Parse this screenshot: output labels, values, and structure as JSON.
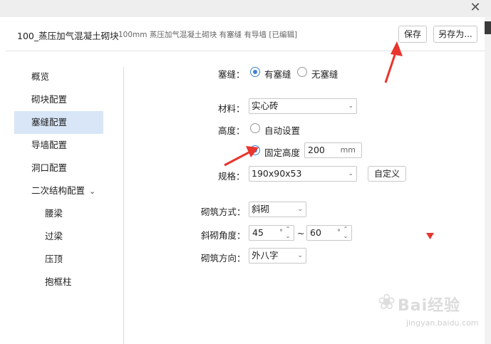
{
  "window": {
    "close_glyph": "✕"
  },
  "header": {
    "title": "100_蒸压加气混凝土砌块",
    "subtitle": "100mm 蒸压加气混凝土砌块 有塞缝 有导墙 [已编辑]",
    "save_label": "保存",
    "save_as_label": "另存为..."
  },
  "sidebar": {
    "items": [
      {
        "label": "概览"
      },
      {
        "label": "砌块配置"
      },
      {
        "label": "塞缝配置"
      },
      {
        "label": "导墙配置"
      },
      {
        "label": "洞口配置"
      },
      {
        "label": "二次结构配置"
      },
      {
        "label": "腰梁"
      },
      {
        "label": "过梁"
      },
      {
        "label": "压顶"
      },
      {
        "label": "抱框柱"
      }
    ],
    "active": "塞缝配置",
    "expand_glyph": "⌄"
  },
  "form": {
    "seam_label": "塞缝：",
    "seam_yes": "有塞缝",
    "seam_no": "无塞缝",
    "seam_selected": "有塞缝",
    "material_label": "材料：",
    "material_value": "实心砖",
    "height_label": "高度：",
    "height_auto": "自动设置",
    "height_fixed": "固定高度",
    "height_selected": "固定高度",
    "height_value": "200",
    "height_unit": "mm",
    "spec_label": "规格：",
    "spec_value": "190x90x53",
    "custom_label": "自定义",
    "method_label": "砌筑方式：",
    "method_value": "斜砌",
    "angle_label": "斜砌角度：",
    "angle_from": "45",
    "angle_to": "60",
    "angle_unit": "°",
    "angle_sep": "~",
    "direction_label": "砌筑方向：",
    "direction_value": "外八字"
  },
  "annotation_color": "#e8352e",
  "accent_color": "#3d80d8",
  "watermark": {
    "brand": "Bai",
    "brand2": "经验",
    "url": "jingyan.baidu.com"
  }
}
